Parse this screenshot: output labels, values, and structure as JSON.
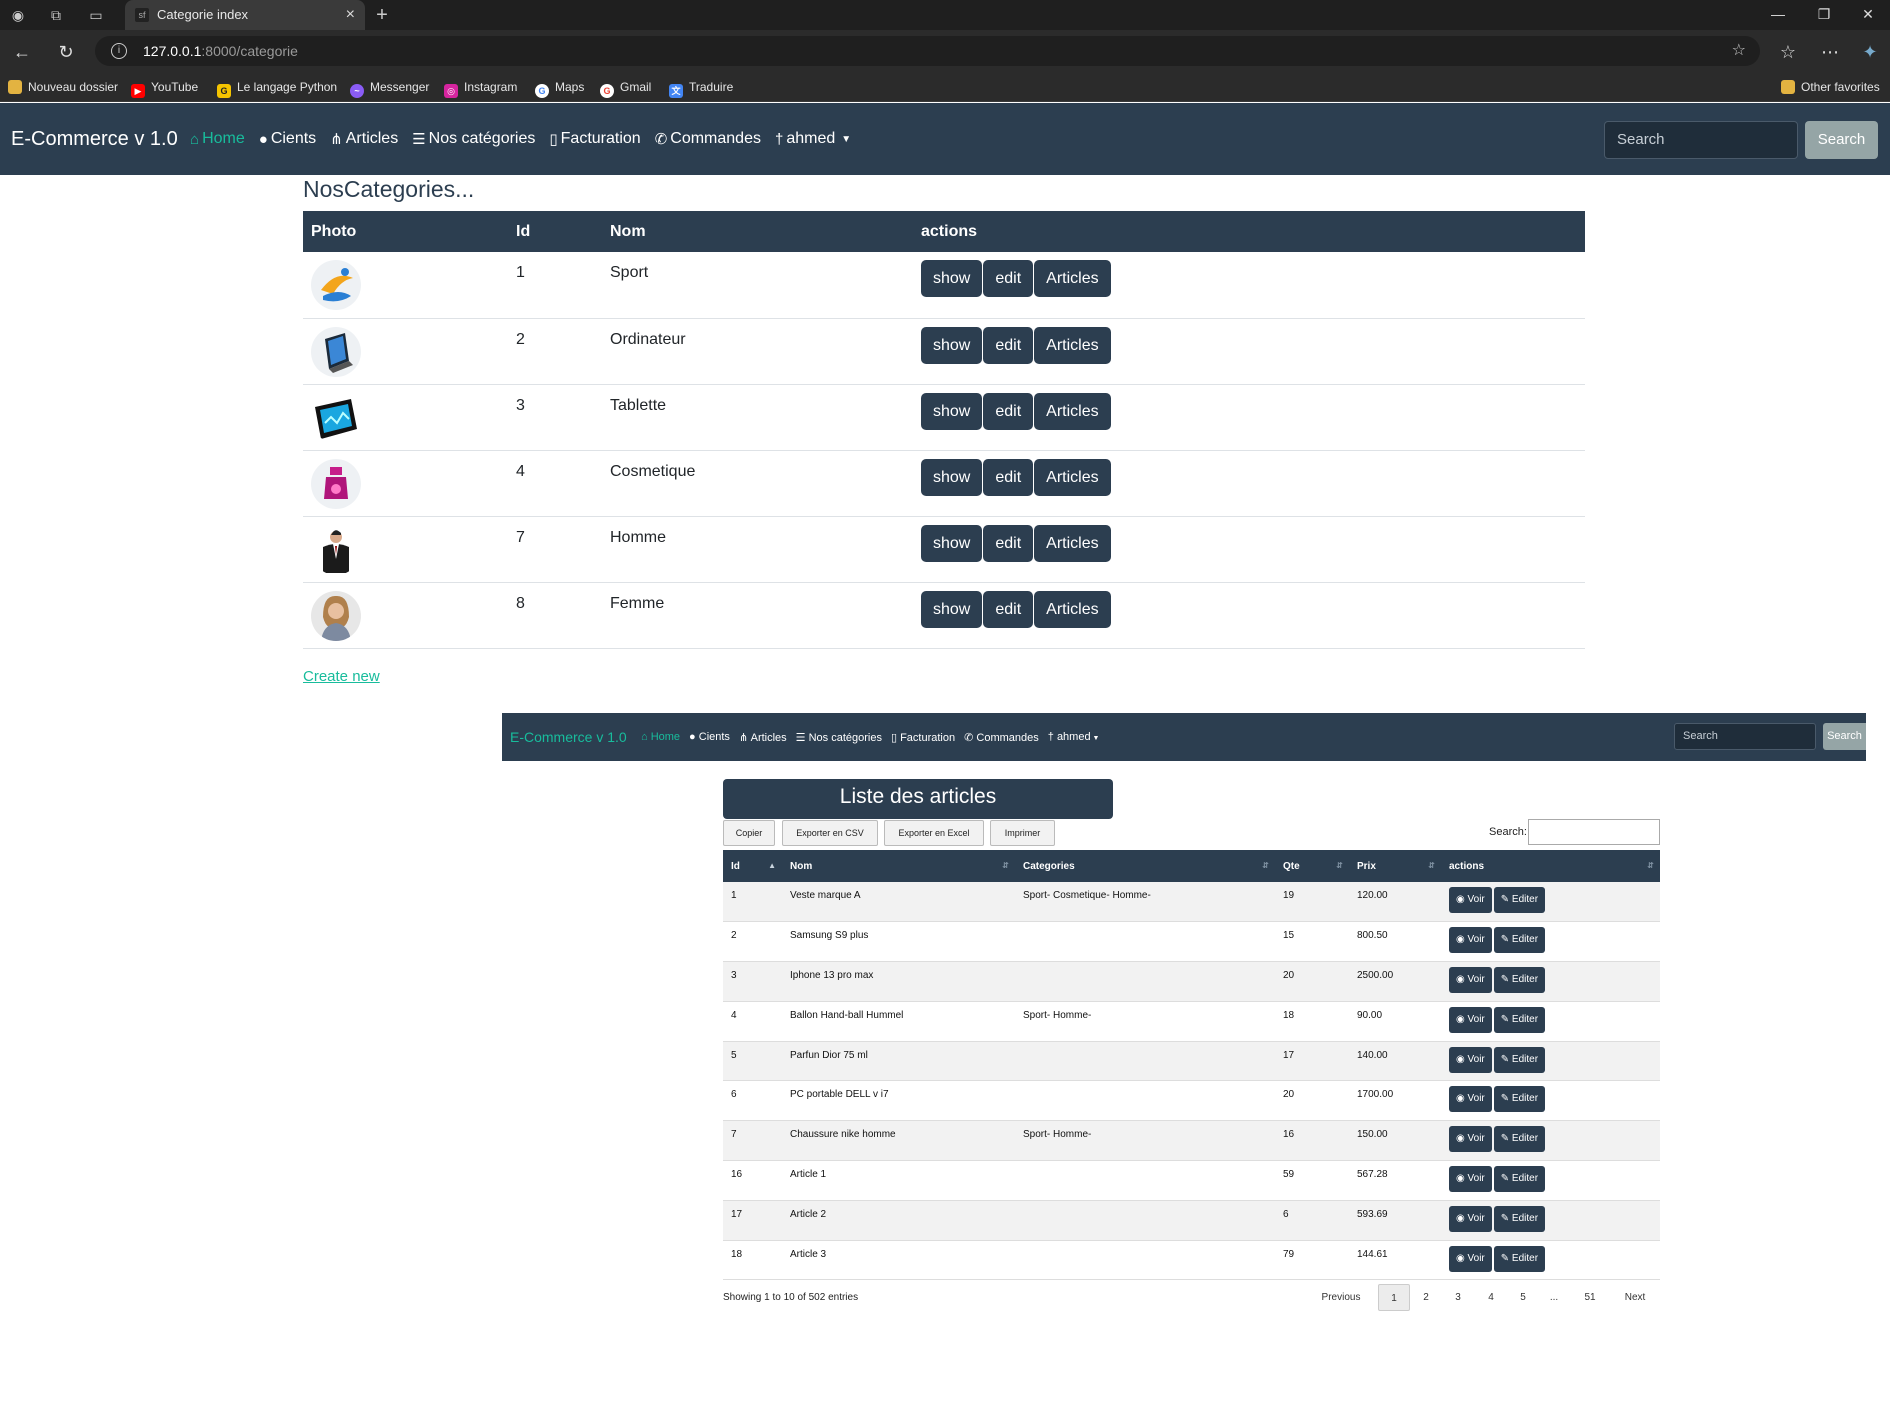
{
  "browser": {
    "tab_title": "Categorie index",
    "url_host": "127.0.0.1",
    "url_path": ":8000/categorie",
    "bookmarks": [
      "Nouveau dossier",
      "YouTube",
      "Le langage Python",
      "Messenger",
      "Instagram",
      "Maps",
      "Gmail",
      "Traduire"
    ],
    "other_favorites": "Other favorites"
  },
  "navbar": {
    "brand": "E-Commerce v 1.0",
    "links": [
      "Home",
      "Cients",
      "Articles",
      "Nos catégories",
      "Facturation",
      "Commandes",
      "ahmed"
    ],
    "search_placeholder": "Search",
    "search_button": "Search"
  },
  "categories": {
    "title": "NosCategories...",
    "headers": [
      "Photo",
      "Id",
      "Nom",
      "actions"
    ],
    "rows": [
      {
        "id": "1",
        "nom": "Sport"
      },
      {
        "id": "2",
        "nom": "Ordinateur"
      },
      {
        "id": "3",
        "nom": "Tablette"
      },
      {
        "id": "4",
        "nom": "Cosmetique"
      },
      {
        "id": "7",
        "nom": "Homme"
      },
      {
        "id": "8",
        "nom": "Femme"
      }
    ],
    "actions": [
      "show",
      "edit",
      "Articles"
    ],
    "create_new": "Create new"
  },
  "articles": {
    "title": "Liste des articles",
    "buttons": [
      "Copier",
      "Exporter en CSV",
      "Exporter en Excel",
      "Imprimer"
    ],
    "search_label": "Search:",
    "headers": [
      "Id",
      "Nom",
      "Categories",
      "Qte",
      "Prix",
      "actions"
    ],
    "rows": [
      {
        "id": "1",
        "nom": "Veste marque A",
        "categories": "Sport- Cosmetique- Homme-",
        "qte": "19",
        "prix": "120.00"
      },
      {
        "id": "2",
        "nom": "Samsung S9 plus",
        "categories": "",
        "qte": "15",
        "prix": "800.50"
      },
      {
        "id": "3",
        "nom": "Iphone 13 pro max",
        "categories": "",
        "qte": "20",
        "prix": "2500.00"
      },
      {
        "id": "4",
        "nom": "Ballon Hand-ball Hummel",
        "categories": "Sport- Homme-",
        "qte": "18",
        "prix": "90.00"
      },
      {
        "id": "5",
        "nom": "Parfun Dior 75 ml",
        "categories": "",
        "qte": "17",
        "prix": "140.00"
      },
      {
        "id": "6",
        "nom": "PC portable DELL v i7",
        "categories": "",
        "qte": "20",
        "prix": "1700.00"
      },
      {
        "id": "7",
        "nom": "Chaussure nike homme",
        "categories": "Sport- Homme-",
        "qte": "16",
        "prix": "150.00"
      },
      {
        "id": "16",
        "nom": "Article 1",
        "categories": "",
        "qte": "59",
        "prix": "567.28"
      },
      {
        "id": "17",
        "nom": "Article 2",
        "categories": "",
        "qte": "6",
        "prix": "593.69"
      },
      {
        "id": "18",
        "nom": "Article 3",
        "categories": "",
        "qte": "79",
        "prix": "144.61"
      }
    ],
    "row_actions": [
      "Voir",
      "Editer"
    ],
    "info": "Showing 1 to 10 of 502 entries",
    "pagination": [
      "Previous",
      "1",
      "2",
      "3",
      "4",
      "5",
      "...",
      "51",
      "Next"
    ]
  }
}
